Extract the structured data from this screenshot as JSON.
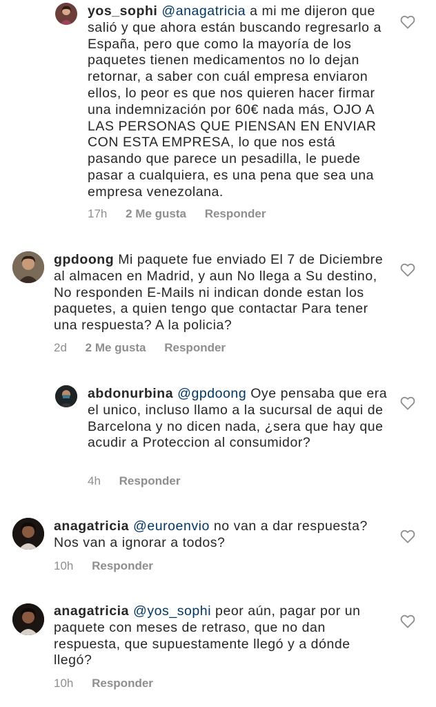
{
  "comments": [
    {
      "username": "yos_sophi",
      "mention": "@anagatricia",
      "text": " a mi me dijeron que salió y que ahora están buscando regresarlo a España, pero que como la mayoría de los paquetes tienen medicamentos no lo dejan retornar, a saber con cuál empresa enviaron ellos, lo peor es que nos quieren hacer firmar una indemnización por 60€ nada más, OJO A LAS PERSONAS QUE PIENSAN EN ENVIAR CON ESTA EMPRESA, lo que nos está pasando que parece un pesadilla, le puede pasar a cualquiera, es una pena que sea una empresa venezolana.",
      "time": "17h",
      "likes": "2 Me gusta",
      "reply": "Responder",
      "avatar_color": "#6b3e3a"
    },
    {
      "username": "gpdoong",
      "mention": "",
      "text": " Mi paquete fue enviado El 7 de Diciembre al almacen en Madrid, y aun No llega a Su destino, No responden E-Mails ni indican donde estan los paquetes, a quien tengo que contactar Para tener una respuesta? A la policia?",
      "time": "2d",
      "likes": "2 Me gusta",
      "reply": "Responder",
      "avatar_color": "#4a3a2e"
    },
    {
      "username": "abdonurbina",
      "mention": "@gpdoong",
      "text": " Oye pensaba que era el unico, incluso llamo a la sucursal de aqui de Barcelona y no dicen nada, ¿sera que hay que acudir a Proteccion al consumidor?",
      "time": "4h",
      "likes": "",
      "reply": "Responder",
      "avatar_color": "#2a2a2a"
    },
    {
      "username": "anagatricia",
      "mention": "@euroenvio",
      "text": " no van a dar respuesta? Nos van a ignorar a todos?",
      "time": "10h",
      "likes": "",
      "reply": "Responder",
      "avatar_color": "#2b211c"
    },
    {
      "username": "anagatricia",
      "mention": "@yos_sophi",
      "text": " peor aún, pagar por un paquete con meses de retraso, que no dan respuesta, que supuestamente llegó y a dónde llegó?",
      "time": "10h",
      "likes": "",
      "reply": "Responder",
      "avatar_color": "#2b211c"
    }
  ],
  "colors": {
    "text": "#262626",
    "mention": "#00376b",
    "meta": "#8e8e8e",
    "heart": "#8e8e8e"
  }
}
